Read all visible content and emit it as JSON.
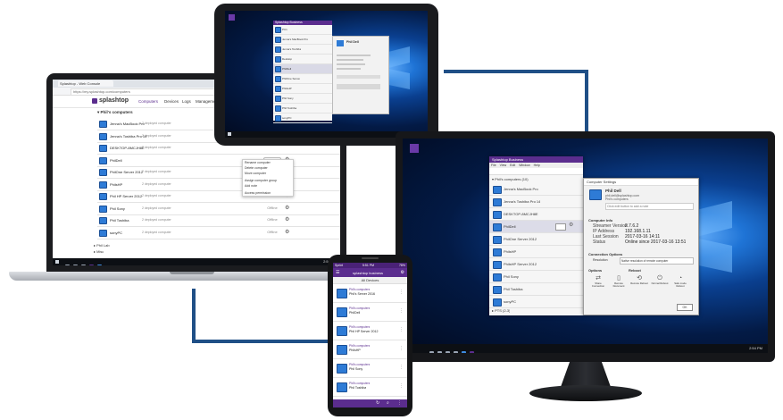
{
  "colors": {
    "accent": "#5b2d8e",
    "connector": "#1f4f86",
    "win_blue": "#1f74d6",
    "taskbar": "#0c0f14"
  },
  "laptop": {
    "tab_title": "Splashtop - Web Console",
    "url": "https://my.splashtop.com/computers",
    "brand": "splashtop",
    "nav": [
      "Computers",
      "Devices",
      "Logs",
      "Management",
      "On-Demand Support"
    ],
    "group_label": "Phil's computers",
    "computers": [
      {
        "name": "Jenna's MacBook Pro",
        "sub": "2 deployed computer"
      },
      {
        "name": "Jenna's Toshiba Pro 14",
        "sub": "2 deployed computer"
      },
      {
        "name": "DESKTOP-8MCJH8E",
        "sub": "2 deployed computer"
      },
      {
        "name": "PhilDell",
        "sub": ""
      },
      {
        "name": "PhilOne Server 2012",
        "sub": "2 deployed computer"
      },
      {
        "name": "PhilsHP",
        "sub": "2 deployed computer"
      },
      {
        "name": "Phil HP Server 2012",
        "sub": "2 deployed computer"
      },
      {
        "name": "Phil Sony",
        "sub": "2 deployed computer"
      },
      {
        "name": "Phil Toshiba",
        "sub": "2 deployed computer"
      },
      {
        "name": "sonyPC",
        "sub": "2 deployed computer"
      }
    ],
    "row_action": "Connect",
    "offline_label": "Offline",
    "context_menu": [
      "Rename computer",
      "Delete computer",
      "Move computer",
      "Assign computer group",
      "Add note",
      "Access permission"
    ],
    "footer_groups": [
      "Phil Lab",
      "Misc"
    ],
    "clock": "2:56 PM"
  },
  "tablet": {
    "title": "Splashtop Business",
    "list": [
      "PC1",
      "Jenna's MacBook Pro",
      "Jenna's Toshiba",
      "Desktop",
      "PhilDell",
      "PhilOne Server",
      "PhilsHP",
      "Phil Sony",
      "Phil Toshiba",
      "sonyPC"
    ],
    "detail_title": "Phil Dell",
    "clock": "2:54 PM"
  },
  "monitor": {
    "app_title": "Splashtop Business",
    "menu": [
      "File",
      "View",
      "Edit",
      "Window",
      "Help"
    ],
    "group_label": "Phil's computers (10)",
    "computers": [
      "Jenna's MacBook Pro",
      "Jenna's Toshiba Pro 14",
      "DESKTOP-8MCJH8E",
      "PhilDell",
      "PhilOne Server 2012",
      "PhilsHP",
      "PhilsHP Server 2012",
      "Phil Sony",
      "Phil Toshiba",
      "sonyPC"
    ],
    "selected": "PhilDell",
    "bottom_group": "PTS (2-3)",
    "settings": {
      "window_title": "Computer Settings",
      "name": "Phil Dell",
      "email": "phil.dell@splashtop.com",
      "group": "Phil's computers",
      "note": "Click edit button to add a note",
      "info_title": "Computer Info",
      "info": [
        {
          "label": "Streamer Version",
          "value": "2.7.6.2"
        },
        {
          "label": "IP Address",
          "value": "192.168.1.11"
        },
        {
          "label": "Last Session",
          "value": "2017-03-16 14:11"
        },
        {
          "label": "Status",
          "value": "Online since 2017-03-16 13:51"
        }
      ],
      "conn_title": "Connection Options",
      "resolution_label": "Resolution",
      "resolution_value": "Native resolution of remote computer",
      "options_title": "Options",
      "reboot_title": "Reboot",
      "options": [
        "Share Connection",
        "Remote Document",
        "Remote Reboot",
        "Normal Reboot",
        "Safe mode Reboot"
      ],
      "ok": "OK"
    },
    "clock": "2:54 PM"
  },
  "phone": {
    "carrier": "Sprint",
    "time": "5:51 PM",
    "battery": "78%",
    "brand": "splashtop business",
    "tab": "All Devices",
    "items": [
      {
        "group": "Phil's computers",
        "name": "Phil's Server 2016"
      },
      {
        "group": "Phil's computers",
        "name": "PhilDell"
      },
      {
        "group": "Phil's computers",
        "name": "Phil HP Server 2012"
      },
      {
        "group": "Phil's computers",
        "name": "PhilsHP"
      },
      {
        "group": "Phil's computers",
        "name": "Phil Sony"
      },
      {
        "group": "Phil's computers",
        "name": "Phil Toshiba"
      }
    ]
  }
}
